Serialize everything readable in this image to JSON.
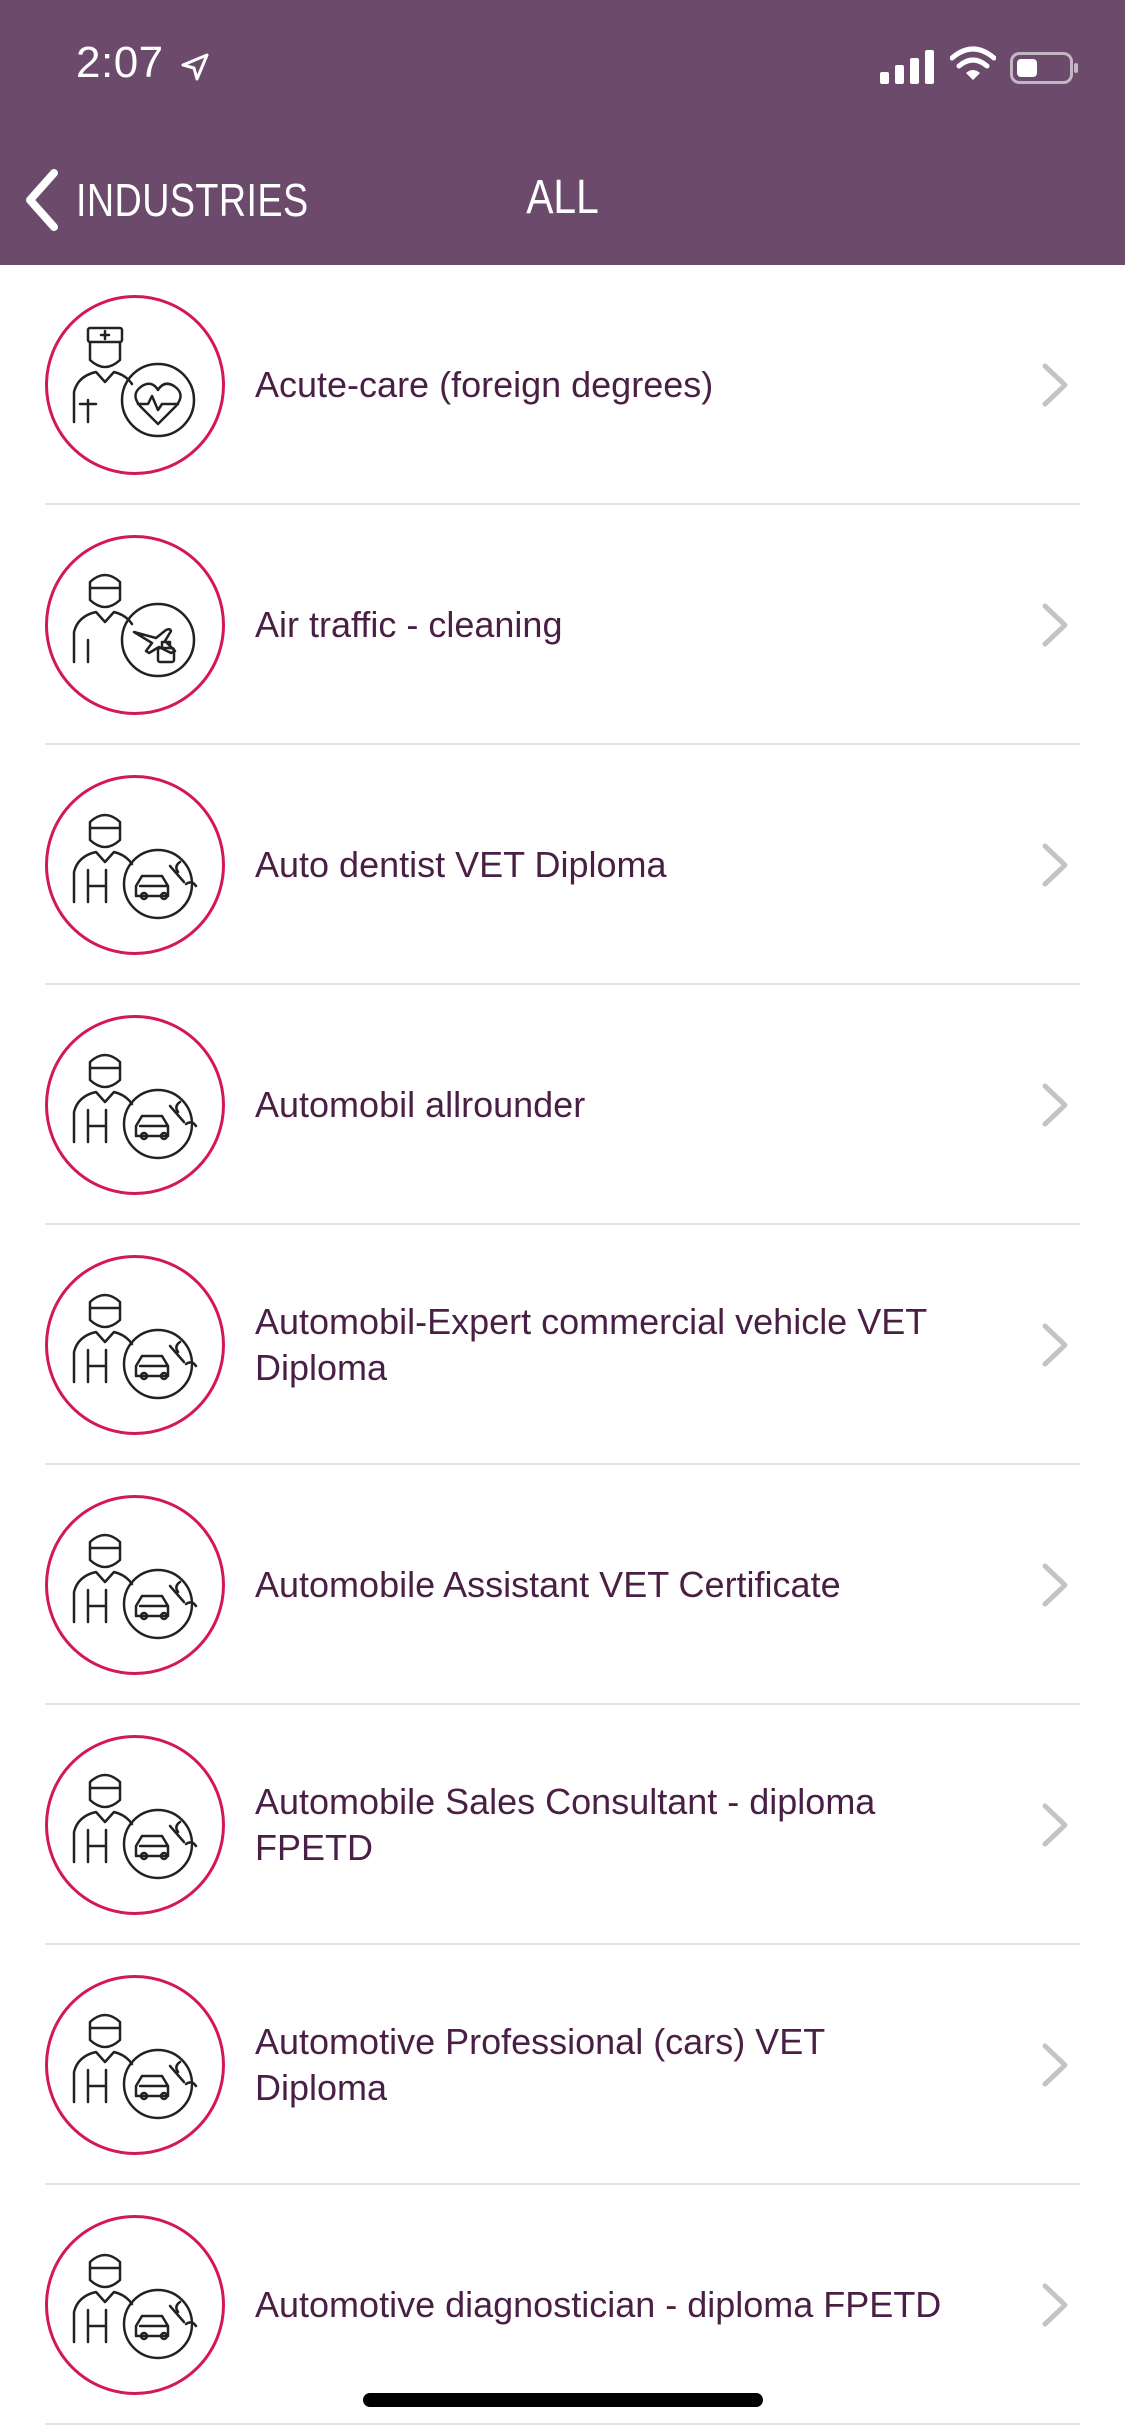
{
  "status_bar": {
    "time": "2:07"
  },
  "navbar": {
    "back_label": "INDUSTRIES",
    "title": "ALL"
  },
  "colors": {
    "header": "#6b4a6b",
    "accent": "#d4165a",
    "text": "#4a1f45"
  },
  "items": [
    {
      "label": "Acute-care (foreign degrees)",
      "icon": "nurse-heart-icon"
    },
    {
      "label": "Air traffic - cleaning",
      "icon": "cleaner-plane-icon"
    },
    {
      "label": "Auto dentist VET Diploma",
      "icon": "mechanic-car-icon"
    },
    {
      "label": "Automobil allrounder",
      "icon": "mechanic-car-icon"
    },
    {
      "label": "Automobil-Expert commercial vehicle VET Diploma",
      "icon": "mechanic-car-icon"
    },
    {
      "label": "Automobile Assistant VET Certificate",
      "icon": "mechanic-car-icon"
    },
    {
      "label": "Automobile Sales Consultant - diploma FPETD",
      "icon": "mechanic-car-icon"
    },
    {
      "label": "Automotive Professional (cars) VET Diploma",
      "icon": "mechanic-car-icon"
    },
    {
      "label": "Automotive diagnostician - diploma FPETD",
      "icon": "mechanic-car-icon"
    }
  ]
}
